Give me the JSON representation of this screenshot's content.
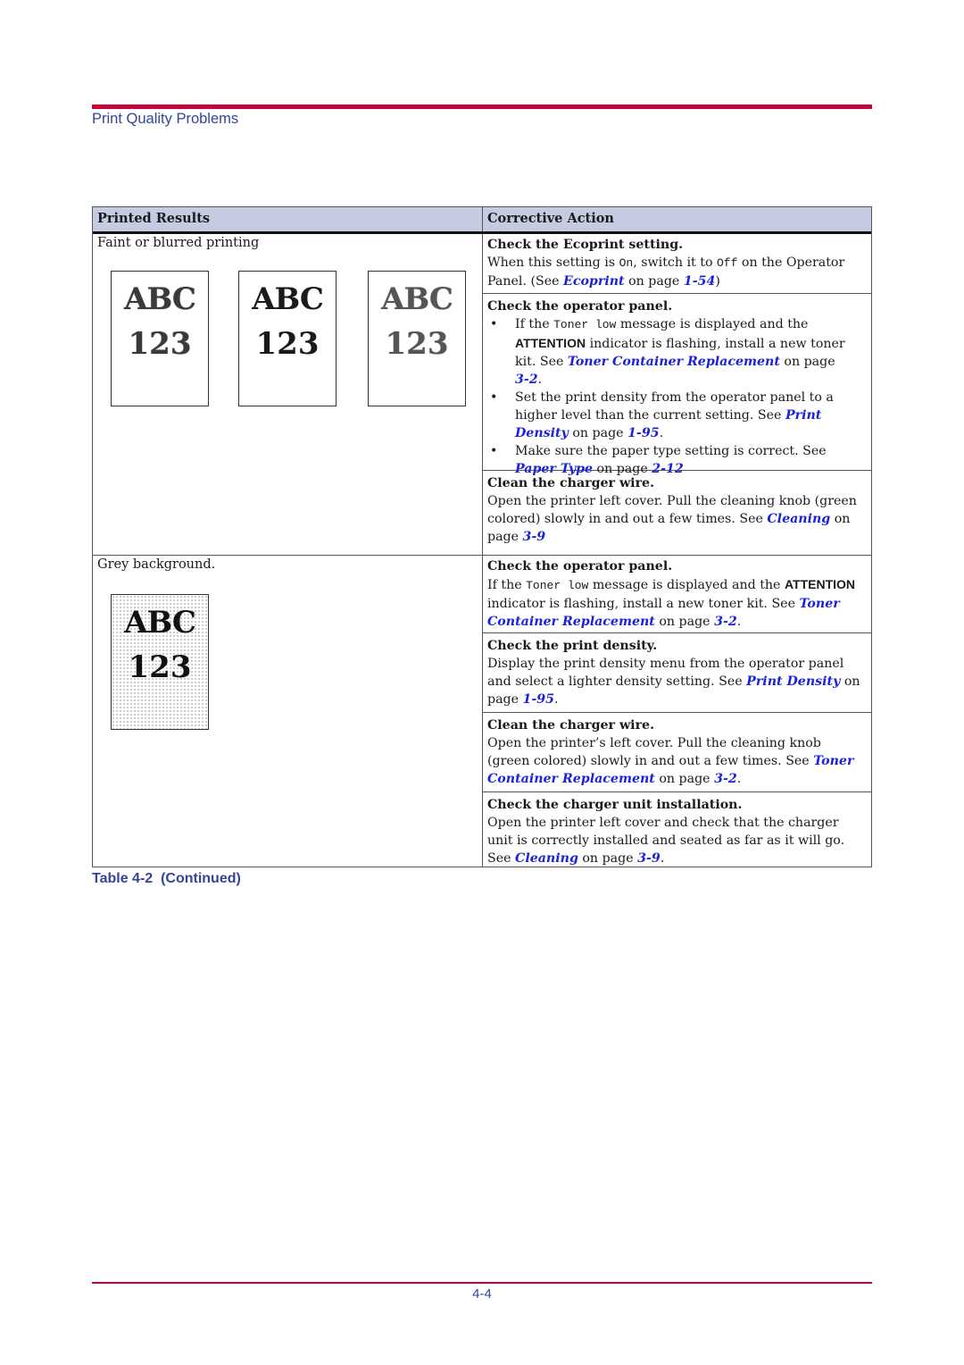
{
  "header": {
    "title": "Print Quality Problems"
  },
  "table": {
    "headers": {
      "left": "Printed Results",
      "right": "Corrective Action"
    },
    "rows": [
      {
        "result": "Faint or blurred printing",
        "samples": [
          {
            "line1": "ABC",
            "line2": "123"
          },
          {
            "line1": "ABC",
            "line2": "123"
          },
          {
            "line1": "ABC",
            "line2": "123"
          }
        ],
        "actions": [
          {
            "title": "Check the Ecoprint setting.",
            "t1": "When this setting is ",
            "code_on": "On",
            "t2": ", switch it to ",
            "code_off": "Off",
            "t3": " on the Operator Panel. (See ",
            "link": "Ecoprint",
            "t4": " on page ",
            "page": "1-54",
            "t5": ")"
          },
          {
            "title": "Check the operator panel.",
            "bullets": [
              {
                "t1": "If the ",
                "code": "Toner low",
                "t2": " message is displayed and the ",
                "strong": "ATTENTION",
                "t3": " indicator is flashing, install a new toner kit. See ",
                "link": "Toner Container Replacement",
                "t4": " on page ",
                "page": "3-2",
                "t5": "."
              },
              {
                "t1": "Set the print density from the operator panel to a higher level than the current setting. See ",
                "link": "Print Density",
                "t4": " on page ",
                "page": "1-95",
                "t5": "."
              },
              {
                "t1": "Make sure the paper type setting is correct. See ",
                "link": "Paper Type",
                "t4": " on page ",
                "page": "2-12",
                "t5": ""
              }
            ]
          },
          {
            "title": "Clean the charger wire.",
            "t1": "Open the printer left cover. Pull the cleaning knob (green colored) slowly in and out a few times. See ",
            "link": "Cleaning",
            "t4": " on page ",
            "page": "3-9",
            "t5": ""
          }
        ]
      },
      {
        "result": "Grey background.",
        "samples": [
          {
            "line1": "ABC",
            "line2": "123"
          }
        ],
        "actions": [
          {
            "title": "Check the operator panel.",
            "t1": "If the ",
            "code": "Toner low",
            "t2": " message is displayed and the ",
            "strong": "ATTENTION",
            "t3": " indicator is flashing, install a new toner kit. See ",
            "link": "Toner Container Replacement",
            "t4": " on page ",
            "page": "3-2",
            "t5": "."
          },
          {
            "title": "Check the print density.",
            "t1": "Display the print density menu from the operator panel and select a lighter density setting. See ",
            "link": "Print Density",
            "t4": " on page ",
            "page": "1-95",
            "t5": "."
          },
          {
            "title": "Clean the charger wire.",
            "t1": "Open the printer’s left cover. Pull the cleaning knob (green colored) slowly in and out a few times. See ",
            "link": "Toner Container Replacement",
            "t4": " on page ",
            "page": "3-2",
            "t5": "."
          },
          {
            "title": "Check the charger unit installation.",
            "t1": "Open the printer left cover and check that the charger unit is correctly installed and seated as far as it will go. See ",
            "link": "Cleaning",
            "t4": " on page ",
            "page": "3-9",
            "t5": "."
          }
        ]
      }
    ]
  },
  "caption": "Table 4-2  (Continued)",
  "footer": {
    "page_number": "4-4"
  },
  "colors": {
    "accent_rule": "#c8003c",
    "heading_blue": "#34449a",
    "link_blue": "#1a23d8",
    "table_header_bg": "#c5cbe0"
  }
}
